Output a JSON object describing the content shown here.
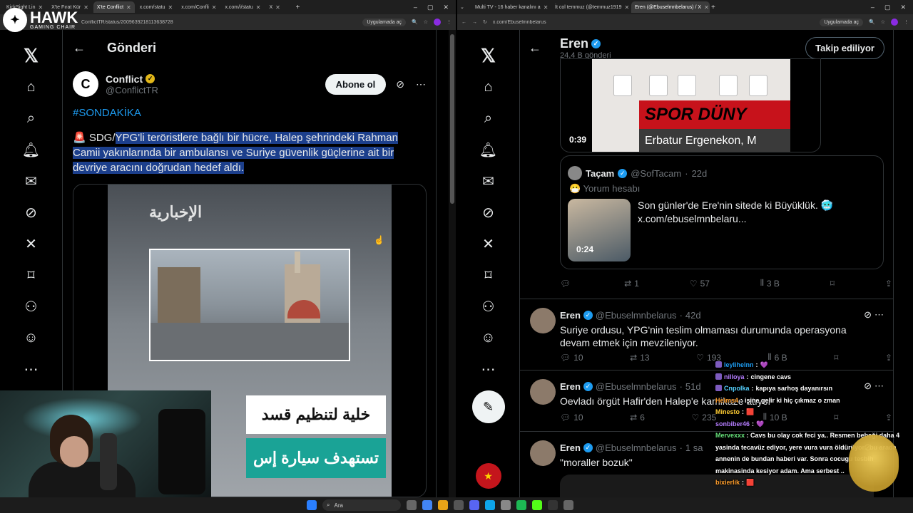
{
  "left": {
    "tabs": [
      "KickSight Lin",
      "X'te Fırat Kür",
      "X'te Conflict",
      "x.com/statu",
      "x.com/Confli",
      "x.com/i/statu",
      "X"
    ],
    "url": "ConflictTR/status/2009639218113638728",
    "open_in_app": "Uygulamada aç",
    "header_title": "Gönderi",
    "author_name": "Conflict",
    "author_handle": "@ConflictTR",
    "subscribe": "Abone ol",
    "hashtag": "#SONDAKİKA",
    "text_plain": "🚨 SDG/",
    "text_hl": "YPG'li teröristlere bağlı bir hücre, Halep şehrindeki Rahman Camii yakınlarında bir ambulansı ve Suriye güvenlik güçlerine ait bir devriye aracını doğrudan hedef aldı.",
    "video_logo": "الإخبارية",
    "caption1": "خلية لتنظيم قسد",
    "caption2": "تستهدف سيارة إس"
  },
  "brand": {
    "name": "HAWK",
    "sub": "GAMING CHAIR"
  },
  "right": {
    "tabs": [
      "Multi TV - 16 haber kanalını a",
      "İt col temmuz (@temmuz1919",
      "Eren (@Ebuselmnbelarus) / X"
    ],
    "url": "x.com/Ebuselmnbelarus",
    "open_in_app": "Uygulamada aç",
    "profile_name": "Eren",
    "profile_posts": "24,4 B gönderi",
    "follow_state": "Takip ediliyor",
    "video_duration": "0:39",
    "tv_banner": "SPOR DÜNY",
    "tv_lower": "Erbatur Ergenekon, M",
    "quote": {
      "name": "Taçam",
      "handle": "@SofTacam",
      "time": "22d",
      "label": "😷 Yorum hesabı",
      "text": "Son günler'de Ere'nin sitede ki Büyüklük. 🥶",
      "link": "x.com/ebuselmnbelaru...",
      "thumb_duration": "0:24"
    },
    "first_stats": {
      "replies": "",
      "reposts": "1",
      "likes": "57",
      "views": "3 B"
    },
    "tweets": [
      {
        "name": "Eren",
        "handle": "@Ebuselmnbelarus",
        "time": "42d",
        "text": "Suriye ordusu, YPG'nin teslim olmaması durumunda operasyona devam etmek için mevzileniyor.",
        "replies": "10",
        "reposts": "13",
        "likes": "193",
        "views": "6 B"
      },
      {
        "name": "Eren",
        "handle": "@Ebuselmnbelarus",
        "time": "51d",
        "text": "Oevladı örgüt Hafir'den Halep'e kamikaze atıyor",
        "replies": "10",
        "reposts": "6",
        "likes": "235",
        "views": "10 B"
      },
      {
        "name": "Eren",
        "handle": "@Ebuselmnbelarus",
        "time": "1 sa",
        "text": "\"moraller bozuk\"",
        "replies": "",
        "reposts": "",
        "likes": "",
        "views": ""
      }
    ]
  },
  "chat": [
    {
      "user": "leylihelnn",
      "msg": "💜",
      "color": "#1d9bf0"
    },
    {
      "user": "nilloya",
      "msg": "cingene cavs",
      "color": "#b57dff"
    },
    {
      "user": "Cnpolka",
      "msg": "kapıya sarhoş dayanırsın",
      "color": "#55d0ff"
    },
    {
      "user": "Helms4",
      "msg": "işine gelir ki hiç çıkmaz o zman",
      "color": "#ff9f2e"
    },
    {
      "user": "Minesto",
      "msg": "🟥",
      "color": "#ffcc33"
    },
    {
      "user": "sonbiber46",
      "msg": "💜",
      "color": "#b57dff"
    },
    {
      "user": "Mervexxx",
      "msg": "Cavs bu olay cok feci ya.. Resmen bebeği daha 4 yasinda tecavüz ediyor, yere vura vura öldürüyor.. bu arada annenin de bundan haberi var. Sonra cocugu tesbih makinasinda kesiyor adam. Ama serbest ..",
      "color": "#66e07a"
    },
    {
      "user": "bixierlik",
      "msg": "🟥",
      "color": "#ff9f2e"
    }
  ],
  "taskbar": {
    "search": "Ara"
  }
}
